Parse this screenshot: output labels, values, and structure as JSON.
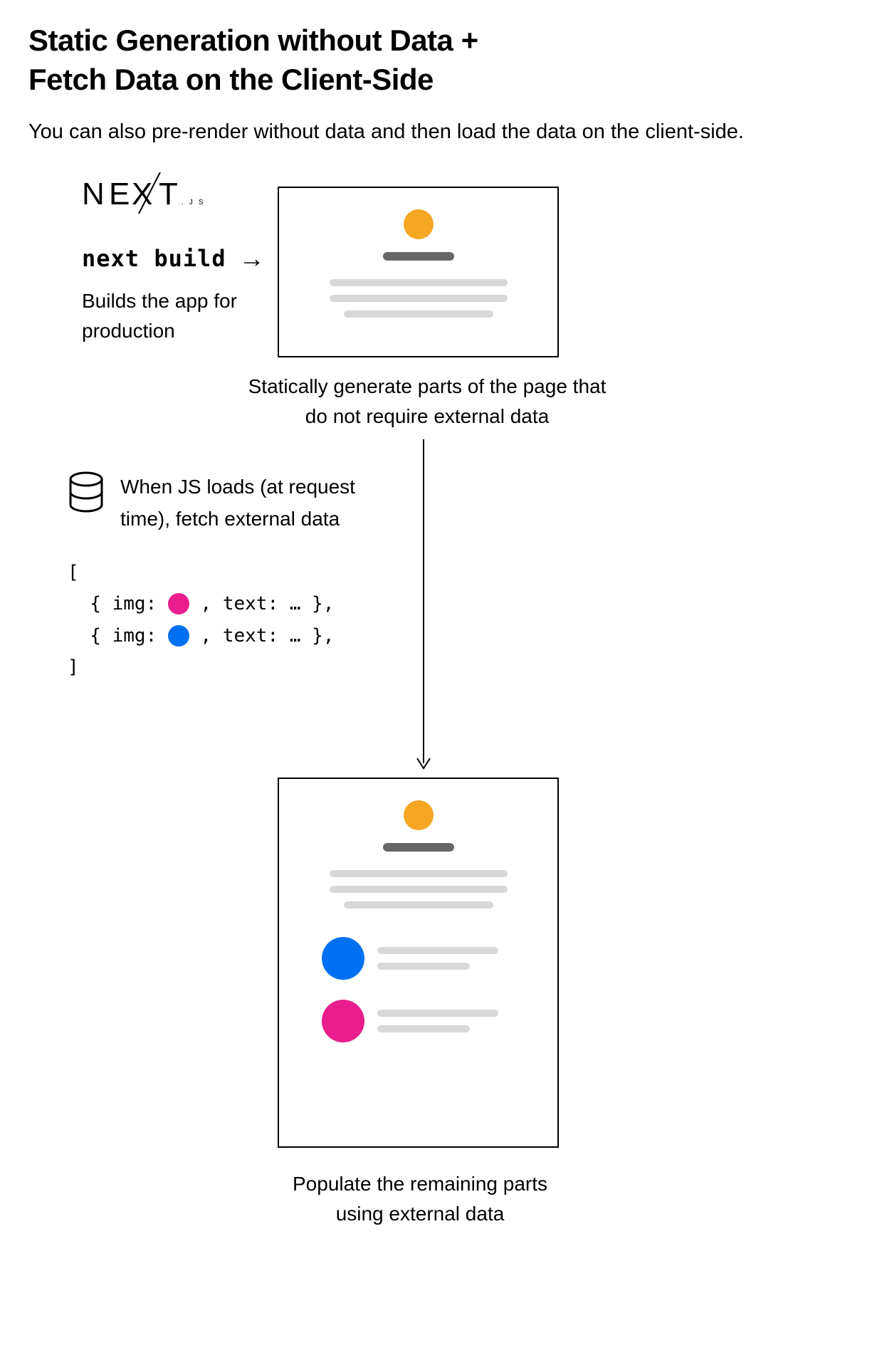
{
  "title_line1": "Static Generation without Data +",
  "title_line2": "Fetch Data on the Client-Side",
  "subtitle": "You can also pre-render without data and then load the data on the client-side.",
  "logo": {
    "text": "NEXT",
    "suffix": ".JS"
  },
  "build": {
    "command": "next build",
    "arrow": "→",
    "description": "Builds the app for production"
  },
  "captions": {
    "static_gen": "Statically generate parts of the page that do not require external data",
    "populate": "Populate the remaining parts using external data"
  },
  "db": {
    "text": "When JS loads (at request time), fetch external data"
  },
  "code": {
    "open": "[",
    "item_prefix": "  { img: ",
    "item_suffix": " , text: … },",
    "close": "]"
  },
  "colors": {
    "orange": "#f5a623",
    "blue": "#0070f3",
    "pink": "#e91e8c",
    "gray_dark": "#666666",
    "gray_light": "#d8d8d8"
  }
}
